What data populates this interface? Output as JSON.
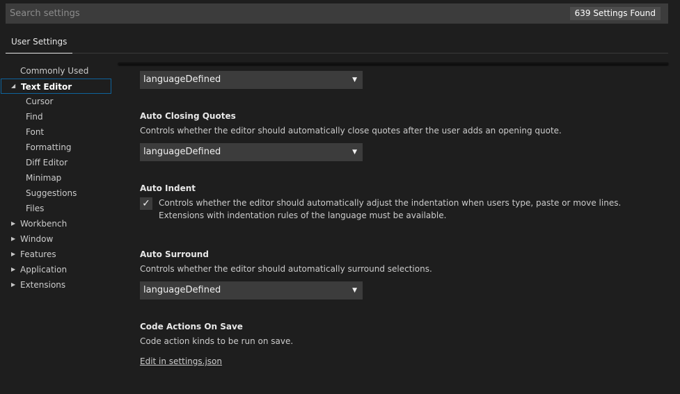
{
  "search": {
    "placeholder": "Search settings",
    "value": "",
    "count": "639 Settings Found"
  },
  "tabs": {
    "user_settings": "User Settings"
  },
  "toc": {
    "commonly_used": "Commonly Used",
    "text_editor": "Text Editor",
    "cursor": "Cursor",
    "find": "Find",
    "font": "Font",
    "formatting": "Formatting",
    "diff_editor": "Diff Editor",
    "minimap": "Minimap",
    "suggestions": "Suggestions",
    "files": "Files",
    "workbench": "Workbench",
    "window": "Window",
    "features": "Features",
    "application": "Application",
    "extensions": "Extensions"
  },
  "settings": {
    "prev_select_value": "languageDefined",
    "auto_closing_quotes": {
      "title": "Auto Closing Quotes",
      "desc": "Controls whether the editor should automatically close quotes after the user adds an opening quote.",
      "value": "languageDefined"
    },
    "auto_indent": {
      "title": "Auto Indent",
      "desc": "Controls whether the editor should automatically adjust the indentation when users type, paste or move lines. Extensions with indentation rules of the language must be available.",
      "checked": true
    },
    "auto_surround": {
      "title": "Auto Surround",
      "desc": "Controls whether the editor should automatically surround selections.",
      "value": "languageDefined"
    },
    "code_actions_on_save": {
      "title": "Code Actions On Save",
      "desc": "Code action kinds to be run on save.",
      "link": "Edit in settings.json"
    }
  },
  "icons": {
    "check": "✓",
    "dropdown_arrow": "▼",
    "expanded_twisty": "◢",
    "collapsed_twisty": "▶"
  },
  "colors": {
    "background": "#1e1e1e",
    "focus_border": "#0e639c",
    "input_background": "#3c3c3c"
  }
}
